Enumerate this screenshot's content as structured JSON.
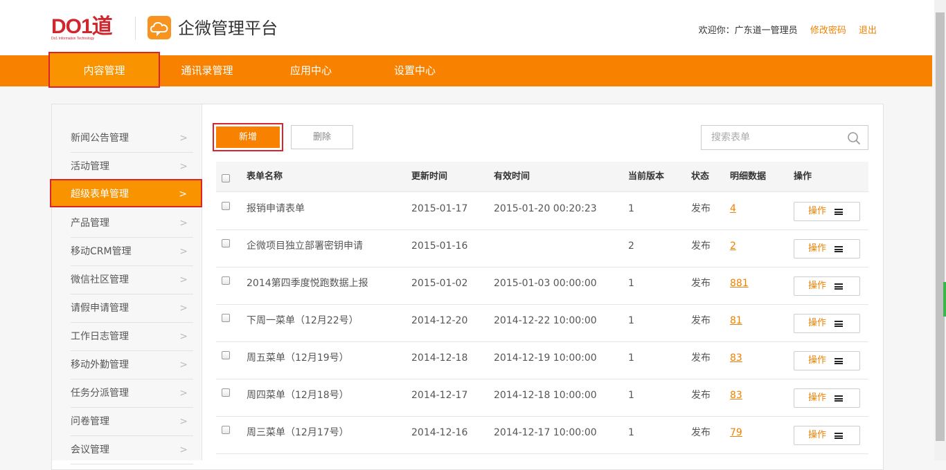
{
  "header": {
    "logo_text": "DO1道",
    "logo_sub": "Do1 Information Technology",
    "app_title": "企微管理平台",
    "welcome": "欢迎你：广东道一管理员",
    "change_password": "修改密码",
    "logout": "退出"
  },
  "nav": {
    "items": [
      {
        "label": "内容管理"
      },
      {
        "label": "通讯录管理"
      },
      {
        "label": "应用中心"
      },
      {
        "label": "设置中心"
      }
    ]
  },
  "sidebar": {
    "items": [
      {
        "label": "新闻公告管理"
      },
      {
        "label": "活动管理"
      },
      {
        "label": "超级表单管理"
      },
      {
        "label": "产品管理"
      },
      {
        "label": "移动CRM管理"
      },
      {
        "label": "微信社区管理"
      },
      {
        "label": "请假申请管理"
      },
      {
        "label": "工作日志管理"
      },
      {
        "label": "移动外勤管理"
      },
      {
        "label": "任务分派管理"
      },
      {
        "label": "问卷管理"
      },
      {
        "label": "会议管理"
      }
    ],
    "chevron": ">"
  },
  "toolbar": {
    "add_label": "新增",
    "delete_label": "删除",
    "search_placeholder": "搜索表单"
  },
  "table": {
    "headers": {
      "name": "表单名称",
      "updated": "更新时间",
      "valid": "有效时间",
      "version": "当前版本",
      "status": "状态",
      "detail": "明细数据",
      "op": "操作"
    },
    "rows": [
      {
        "name": "报销申请表单",
        "updated": "2015-01-17",
        "valid": "2015-01-20 00:20:23",
        "version": "1",
        "status": "发布",
        "detail": "4",
        "op": "操作"
      },
      {
        "name": "企微项目独立部署密钥申请",
        "updated": "2015-01-16",
        "valid": "",
        "version": "2",
        "status": "发布",
        "detail": "2",
        "op": "操作"
      },
      {
        "name": "2014第四季度悦跑数据上报",
        "updated": "2015-01-02",
        "valid": "2015-01-03 00:00:00",
        "version": "1",
        "status": "发布",
        "detail": "881",
        "op": "操作"
      },
      {
        "name": "下周一菜单（12月22号）",
        "updated": "2014-12-20",
        "valid": "2014-12-22 10:00:00",
        "version": "1",
        "status": "发布",
        "detail": "81",
        "op": "操作"
      },
      {
        "name": "周五菜单（12月19号）",
        "updated": "2014-12-18",
        "valid": "2014-12-19 10:00:00",
        "version": "1",
        "status": "发布",
        "detail": "83",
        "op": "操作"
      },
      {
        "name": "周四菜单（12月18号）",
        "updated": "2014-12-17",
        "valid": "2014-12-18 10:00:00",
        "version": "1",
        "status": "发布",
        "detail": "83",
        "op": "操作"
      },
      {
        "name": "周三菜单（12月17号）",
        "updated": "2014-12-16",
        "valid": "2014-12-17 10:00:00",
        "version": "1",
        "status": "发布",
        "detail": "79",
        "op": "操作"
      }
    ]
  },
  "colors": {
    "accent": "#f88200",
    "highlight_border": "#d9232d",
    "brand_red": "#d0272f",
    "link": "#f08100"
  }
}
